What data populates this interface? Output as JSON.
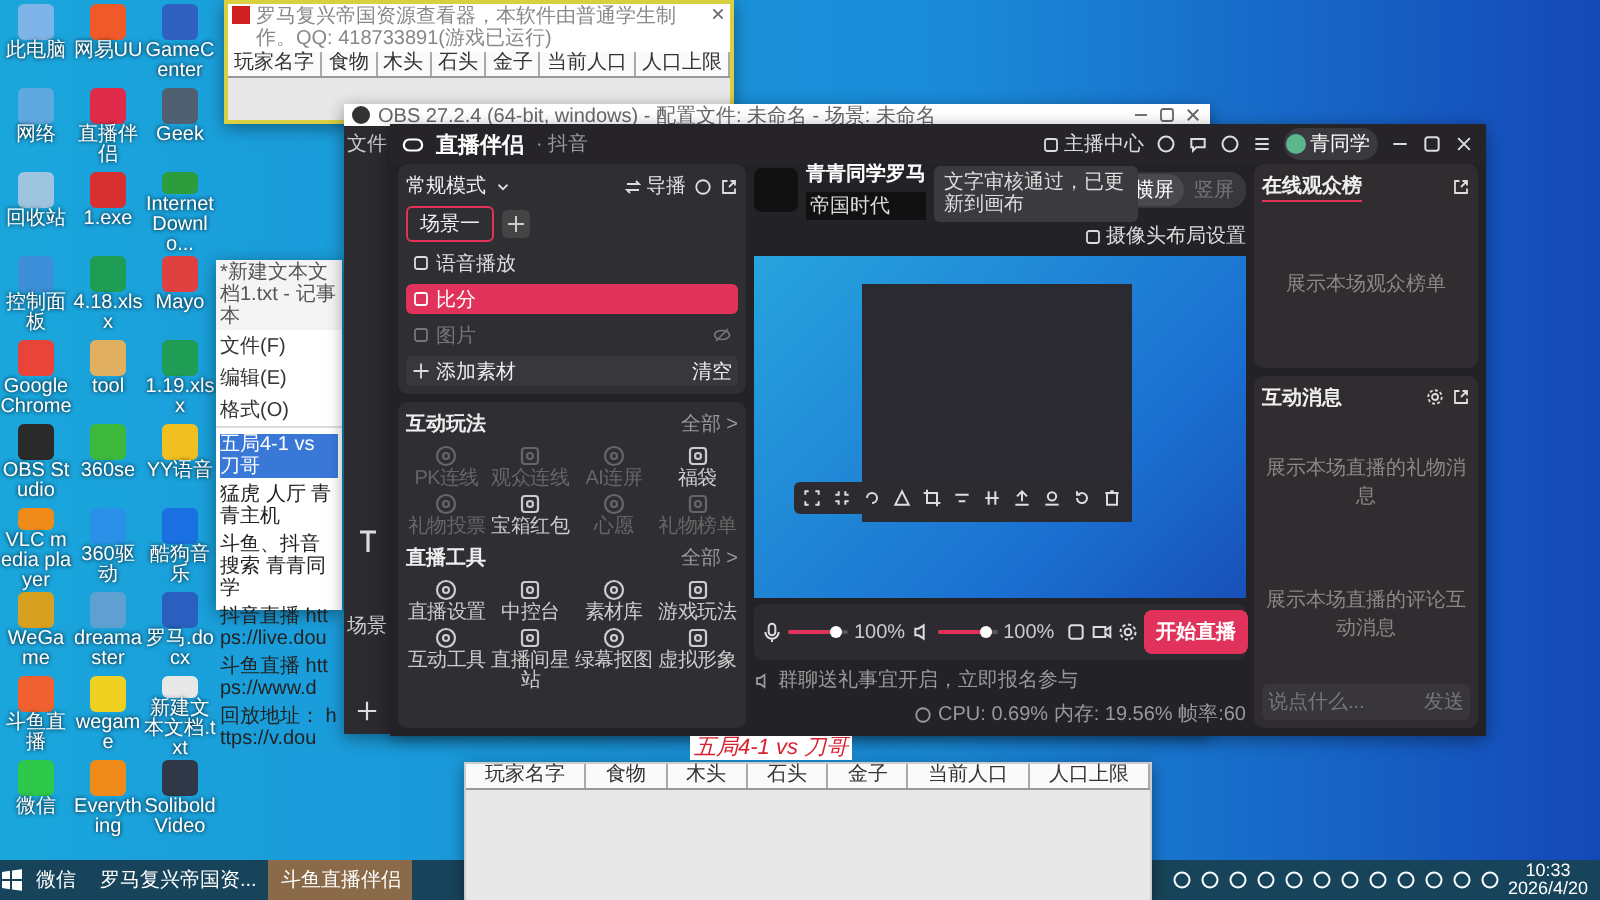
{
  "desktop": {
    "icons": [
      {
        "label": "此电脑",
        "color": "#7fb4e8"
      },
      {
        "label": "网络",
        "color": "#5fa8e0"
      },
      {
        "label": "回收站",
        "color": "#9fc4e0"
      },
      {
        "label": "控制面板",
        "color": "#3c8fd8"
      },
      {
        "label": "Google Chrome",
        "color": "#e8443a"
      },
      {
        "label": "OBS Studio",
        "color": "#2a2a2a"
      },
      {
        "label": "VLC media player",
        "color": "#f08a18"
      },
      {
        "label": "WeGame",
        "color": "#d8a020"
      },
      {
        "label": "斗鱼直播",
        "color": "#f06030"
      },
      {
        "label": "微信",
        "color": "#2ec84a"
      },
      {
        "label": "网易UU",
        "color": "#f05a28"
      },
      {
        "label": "直播伴侣",
        "color": "#e02a4a"
      },
      {
        "label": "1.exe",
        "color": "#d83030"
      },
      {
        "label": "4.18.xlsx",
        "color": "#1f9d55"
      },
      {
        "label": "tool",
        "color": "#e0b060"
      },
      {
        "label": "360se",
        "color": "#3cb83c"
      },
      {
        "label": "360驱动",
        "color": "#2a90e8"
      },
      {
        "label": "dreamaster",
        "color": "#60a0d0"
      },
      {
        "label": "wegame",
        "color": "#f0d020"
      },
      {
        "label": "Everything",
        "color": "#f08a18"
      },
      {
        "label": "GameCenter",
        "color": "#3060c0"
      },
      {
        "label": "Geek",
        "color": "#506070"
      },
      {
        "label": "Internet Downlo...",
        "color": "#2c9c3c"
      },
      {
        "label": "Mayo",
        "color": "#e04040"
      },
      {
        "label": "1.19.xlsx",
        "color": "#1f9d55"
      },
      {
        "label": "YY语音",
        "color": "#f0c020"
      },
      {
        "label": "酷狗音乐",
        "color": "#1a70e0"
      },
      {
        "label": "罗马.docx",
        "color": "#2a5fc0"
      },
      {
        "label": "新建文本文档.txt",
        "color": "#e8e8e8"
      },
      {
        "label": "Solibold Video",
        "color": "#303848"
      }
    ]
  },
  "resource_viewer": {
    "title": "罗马复兴帝国资源查看器，本软件由普通学生制作。QQ: 418733891(游戏已运行)",
    "columns": [
      "玩家名字",
      "食物",
      "木头",
      "石头",
      "金子",
      "当前人口",
      "人口上限"
    ]
  },
  "notepad": {
    "title": "*新建文本文档1.txt - 记事本",
    "menu": [
      "文件(F)",
      "编辑(E)",
      "格式(O)"
    ],
    "lines": [
      {
        "text": "五局4-1 vs 刀哥",
        "selected": true
      },
      {
        "text": "猛虎 人厅 青青主机",
        "selected": false
      },
      {
        "text": "斗鱼、抖音搜索 青青同学",
        "selected": false
      },
      {
        "text": "抖音直播 https://live.dou",
        "selected": false
      },
      {
        "text": "斗鱼直播 https://www.d",
        "selected": false
      },
      {
        "text": "回放地址： https://v.dou",
        "selected": false
      }
    ]
  },
  "obs": {
    "title": "OBS 27.2.4 (64-bit, windows) - 配置文件: 未命名 - 场景: 未命名",
    "menu": "文件",
    "scenes_label": "场景"
  },
  "app": {
    "brand": "直播伴侣",
    "platform": "· 抖音",
    "anchor_center": "主播中心",
    "user": "青同学",
    "mode": "常规模式",
    "director": "导播",
    "scenes": [
      {
        "label": "场景一",
        "selected": true
      }
    ],
    "sources": [
      {
        "label": "语音播放",
        "selected": false,
        "hidden": false
      },
      {
        "label": "比分",
        "selected": true,
        "hidden": false
      },
      {
        "label": "图片",
        "selected": false,
        "hidden": true
      }
    ],
    "add_source": "添加素材",
    "clear": "清空",
    "interactive": {
      "title": "互动玩法",
      "all": "全部 >",
      "items": [
        {
          "label": "PK连线",
          "disabled": true
        },
        {
          "label": "观众连线",
          "disabled": true
        },
        {
          "label": "AI连屏",
          "disabled": true
        },
        {
          "label": "福袋",
          "disabled": false
        },
        {
          "label": "礼物投票",
          "disabled": true
        },
        {
          "label": "宝箱红包",
          "disabled": false
        },
        {
          "label": "心愿",
          "disabled": true
        },
        {
          "label": "礼物榜单",
          "disabled": true
        }
      ]
    },
    "tools": {
      "title": "直播工具",
      "all": "全部 >",
      "items": [
        {
          "label": "直播设置",
          "disabled": false
        },
        {
          "label": "中控台",
          "disabled": false
        },
        {
          "label": "素材库",
          "disabled": false
        },
        {
          "label": "游戏玩法",
          "disabled": false
        },
        {
          "label": "互动工具",
          "disabled": false
        },
        {
          "label": "直播间星站",
          "disabled": false
        },
        {
          "label": "绿幕抠图",
          "disabled": false
        },
        {
          "label": "虚拟形象",
          "disabled": false
        }
      ]
    },
    "streamer": {
      "name": "青青同学罗马",
      "tag": "帝国时代"
    },
    "toast": "文字审核通过，已更新到画布",
    "orientation": [
      {
        "label": "横屏",
        "selected": true
      },
      {
        "label": "竖屏",
        "selected": false
      }
    ],
    "camera_layout": "摄像头布局设置",
    "mic": {
      "level": 0.8,
      "reading": "100%"
    },
    "speaker": {
      "level": 0.8,
      "reading": "100%"
    },
    "start_button": "开始直播",
    "notice": "群聊送礼事宜开启，立即报名参与",
    "stats": "CPU: 0.69%  内存: 19.56%  帧率:60",
    "viewers": {
      "title": "在线观众榜",
      "empty": "展示本场观众榜单"
    },
    "messages": {
      "title": "互动消息",
      "gift_empty": "展示本场直播的礼物消息",
      "comment_empty": "展示本场直播的评论互动消息",
      "placeholder": "说点什么...",
      "send": "发送"
    }
  },
  "overlay_text": "五局4-1 vs 刀哥",
  "bottom_viewer": {
    "columns": [
      "玩家名字",
      "食物",
      "木头",
      "石头",
      "金子",
      "当前人口",
      "人口上限"
    ]
  },
  "taskbar": {
    "items": [
      {
        "label": "微信",
        "selected": false
      },
      {
        "label": "罗马复兴帝国资...",
        "selected": false
      },
      {
        "label": "斗鱼直播伴侣",
        "selected": true
      }
    ],
    "time": "10:33",
    "date": "2026/4/20"
  }
}
